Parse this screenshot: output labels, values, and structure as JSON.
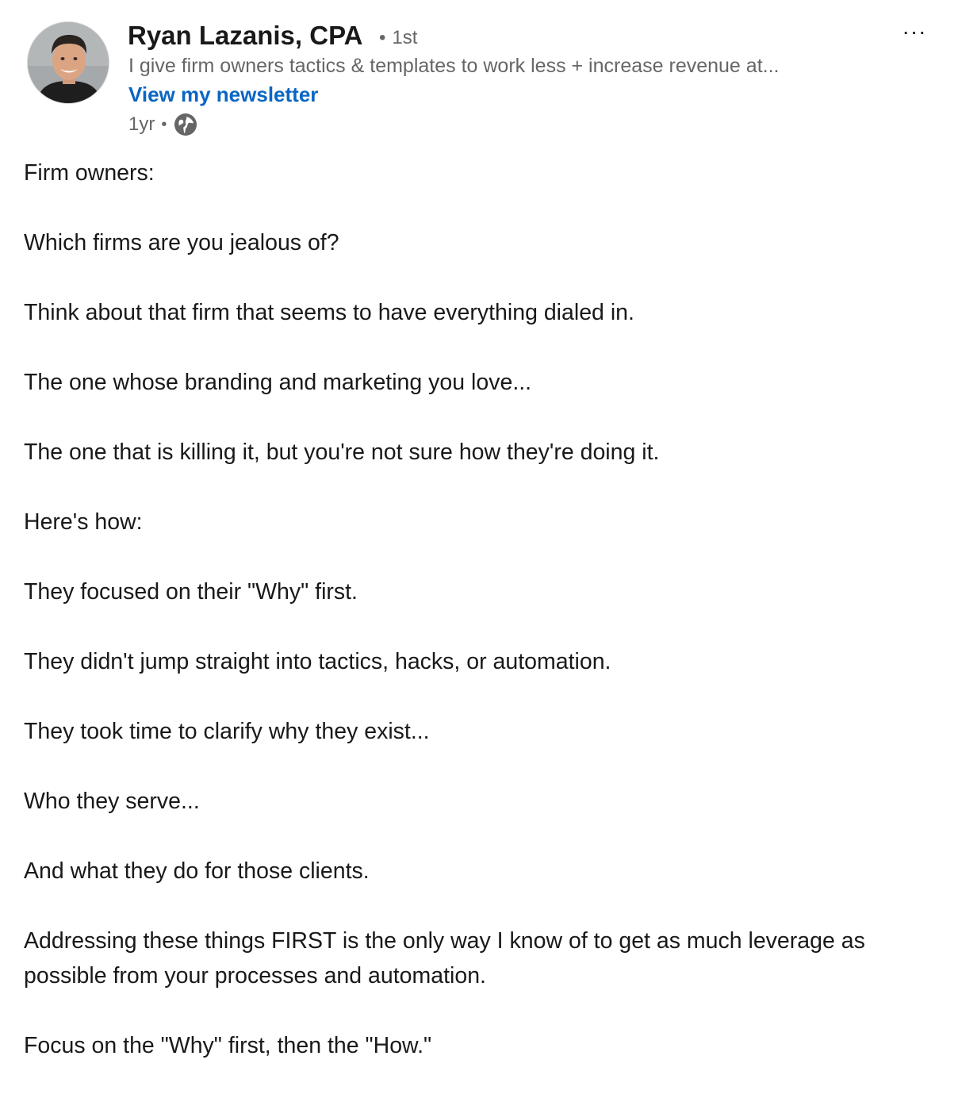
{
  "author": {
    "name": "Ryan Lazanis, CPA",
    "degree": "1st",
    "headline": "I give firm owners tactics & templates to work less + increase revenue at...",
    "newsletter_link": "View my newsletter",
    "timestamp": "1yr",
    "visibility_icon": "globe-icon",
    "avatar_icon": "profile-photo"
  },
  "menu": {
    "more_label": "···"
  },
  "post": {
    "paragraphs": [
      "Firm owners:",
      "Which firms are you jealous of?",
      "Think about that firm that seems to have everything dialed in.",
      "The one whose branding and marketing you love...",
      "The one that is killing it, but you're not sure how they're doing it.",
      "Here's how:",
      "They focused on their \"Why\" first.",
      "They didn't jump straight into tactics, hacks, or automation.",
      "They took time to clarify why they exist...",
      "Who they serve...",
      "And what they do for those clients.",
      "Addressing these things FIRST is the only way I know of to get as much leverage as possible from your processes and automation.",
      "Focus on the \"Why\" first, then the \"How.\""
    ]
  },
  "colors": {
    "link": "#0a66c2",
    "text": "#191919",
    "muted": "#666666"
  }
}
